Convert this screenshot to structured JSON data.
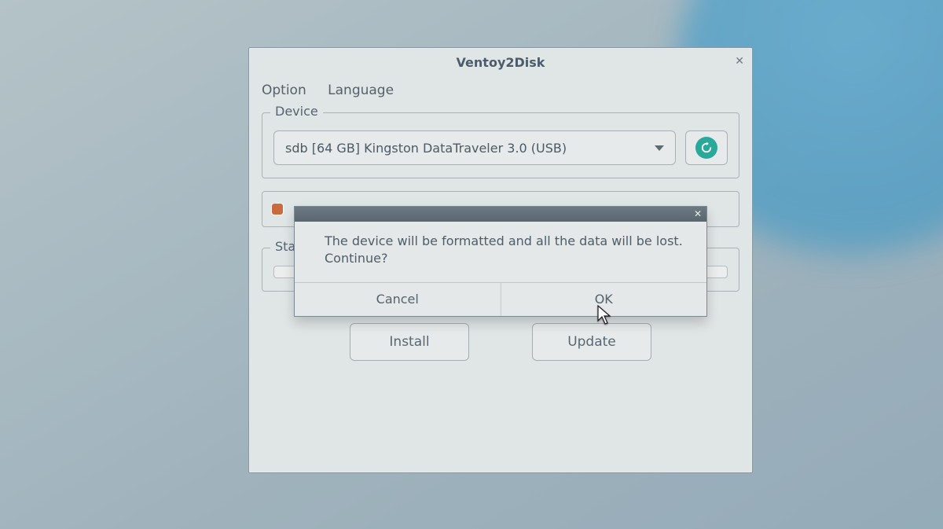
{
  "window": {
    "title": "Ventoy2Disk",
    "close_glyph": "✕"
  },
  "menu": {
    "option": "Option",
    "language": "Language"
  },
  "device": {
    "group_label": "Device",
    "selected": "sdb  [64 GB]  Kingston DataTraveler 3.0 (USB)"
  },
  "status": {
    "group_label": "Status"
  },
  "buttons": {
    "install": "Install",
    "update": "Update"
  },
  "dialog": {
    "line1": "The device will be formatted and all the data will be lost.",
    "line2": "Continue?",
    "cancel": "Cancel",
    "ok": "OK",
    "close_glyph": "✕"
  }
}
